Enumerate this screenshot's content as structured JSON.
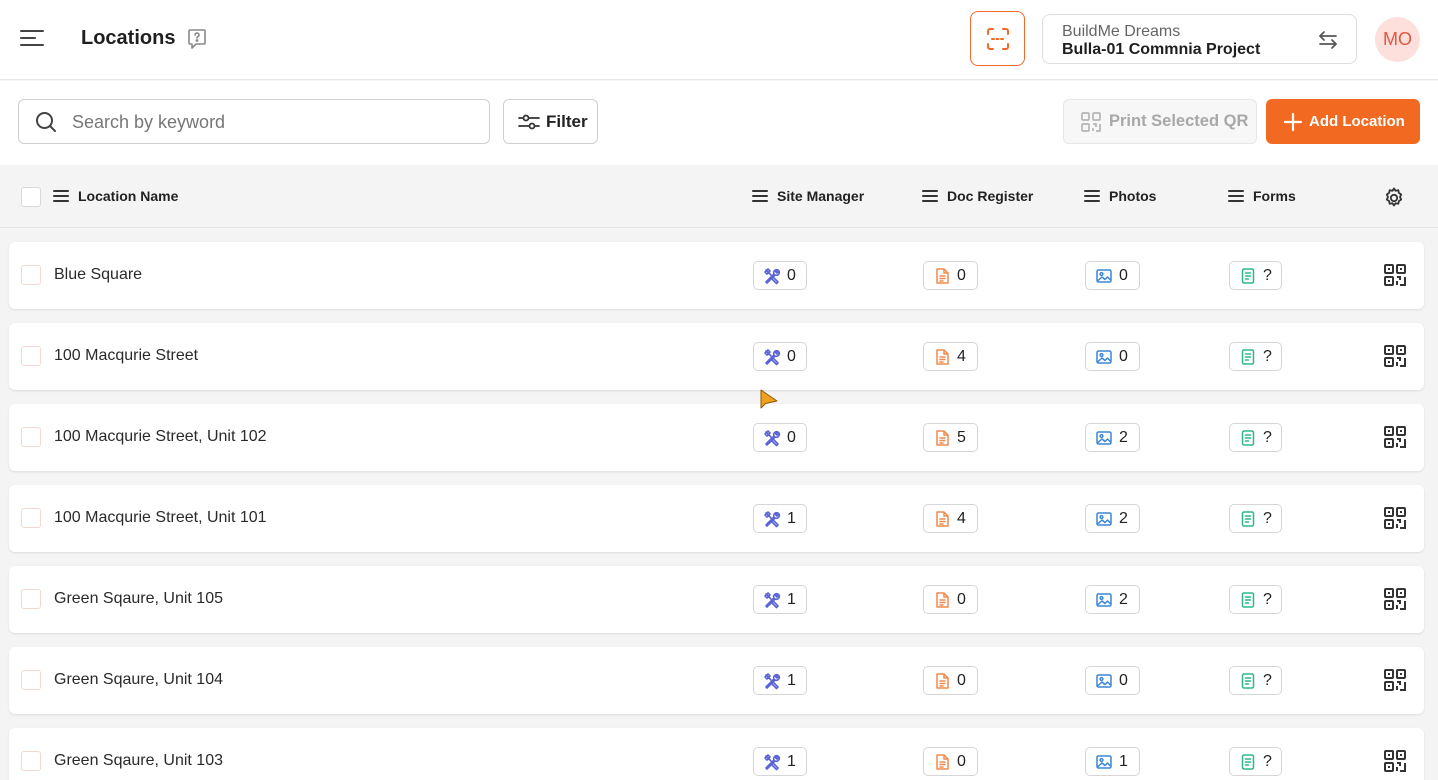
{
  "header": {
    "title": "Locations",
    "project_company": "BuildMe Dreams",
    "project_name": "Bulla-01 Commnia Project",
    "avatar_initials": "MO"
  },
  "toolbar": {
    "search_placeholder": "Search by keyword",
    "filter_label": "Filter",
    "print_label": "Print Selected QR",
    "add_label": "Add Location"
  },
  "columns": {
    "name": "Location Name",
    "site_manager": "Site Manager",
    "doc_register": "Doc Register",
    "photos": "Photos",
    "forms": "Forms"
  },
  "rows": [
    {
      "name": "Blue Square",
      "site": "0",
      "docs": "0",
      "photos": "0",
      "forms": "?"
    },
    {
      "name": "100 Macqurie Street",
      "site": "0",
      "docs": "4",
      "photos": "0",
      "forms": "?"
    },
    {
      "name": "100 Macqurie Street, Unit 102",
      "site": "0",
      "docs": "5",
      "photos": "2",
      "forms": "?"
    },
    {
      "name": "100 Macqurie Street, Unit 101",
      "site": "1",
      "docs": "4",
      "photos": "2",
      "forms": "?"
    },
    {
      "name": "Green Sqaure, Unit 105",
      "site": "1",
      "docs": "0",
      "photos": "2",
      "forms": "?"
    },
    {
      "name": "Green Sqaure, Unit 104",
      "site": "1",
      "docs": "0",
      "photos": "0",
      "forms": "?"
    },
    {
      "name": "Green Sqaure, Unit 103",
      "site": "1",
      "docs": "0",
      "photos": "1",
      "forms": "?"
    }
  ],
  "colors": {
    "accent": "#f26a21",
    "site_icon": "#5a63d8",
    "doc_icon": "#f08a4b",
    "photo_icon": "#3b86d6",
    "form_icon": "#2eb88a"
  },
  "icons": [
    "menu-icon",
    "help-icon",
    "scan-icon",
    "swap-icon",
    "search-icon",
    "filter-icon",
    "qr-icon",
    "plus-icon",
    "gear-icon",
    "tools-icon",
    "document-icon",
    "image-icon",
    "form-icon"
  ]
}
